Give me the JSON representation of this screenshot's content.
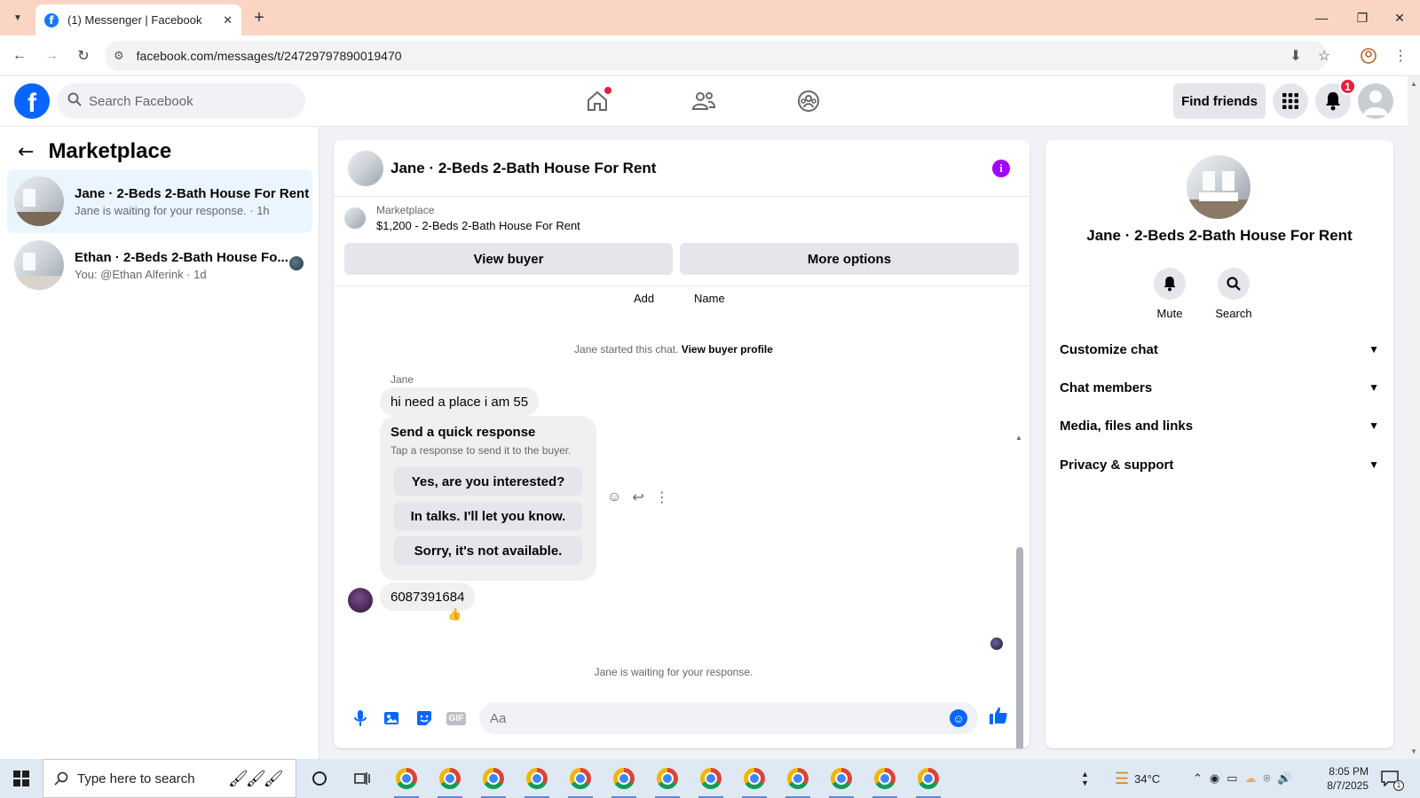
{
  "browser": {
    "tab_title": "(1) Messenger | Facebook",
    "url": "facebook.com/messages/t/24729797890019470"
  },
  "header": {
    "search_placeholder": "Search Facebook",
    "find_friends": "Find friends",
    "notification_count": "1"
  },
  "sidebar": {
    "title": "Marketplace",
    "conversations": [
      {
        "name": "Jane · 2-Beds 2-Bath House For Rent",
        "sub": "Jane is waiting for your response. · 1h"
      },
      {
        "name": "Ethan · 2-Beds 2-Bath House Fo...",
        "sub": "You: @Ethan Alferink · 1d"
      }
    ]
  },
  "chat": {
    "title": "Jane · 2-Beds 2-Bath House For Rent",
    "listing_label": "Marketplace",
    "listing_price": "$1,200 - 2-Beds 2-Bath House For Rent",
    "view_buyer": "View buyer",
    "more_options": "More options",
    "add_label": "Add",
    "name_label": "Name",
    "started_text": "Jane started this chat.",
    "view_buyer_profile": "View buyer profile",
    "sender_name": "Jane",
    "message_1": "hi need a place i am 55",
    "quick_title": "Send a quick response",
    "quick_sub": "Tap a response to send it to the buyer.",
    "quick_options": [
      "Yes, are you interested?",
      "In talks. I'll let you know.",
      "Sorry, it's not available."
    ],
    "message_2": "6087391684",
    "waiting_text": "Jane is waiting for your response.",
    "input_placeholder": "Aa",
    "gif_label": "GIF"
  },
  "details": {
    "title": "Jane · 2-Beds 2-Bath House For Rent",
    "mute": "Mute",
    "search": "Search",
    "sections": [
      "Customize chat",
      "Chat members",
      "Media, files and links",
      "Privacy & support"
    ]
  },
  "taskbar": {
    "search_placeholder": "Type here to search",
    "temperature": "34°C",
    "time": "8:05 PM",
    "date": "8/7/2025",
    "notification_count": "1"
  }
}
